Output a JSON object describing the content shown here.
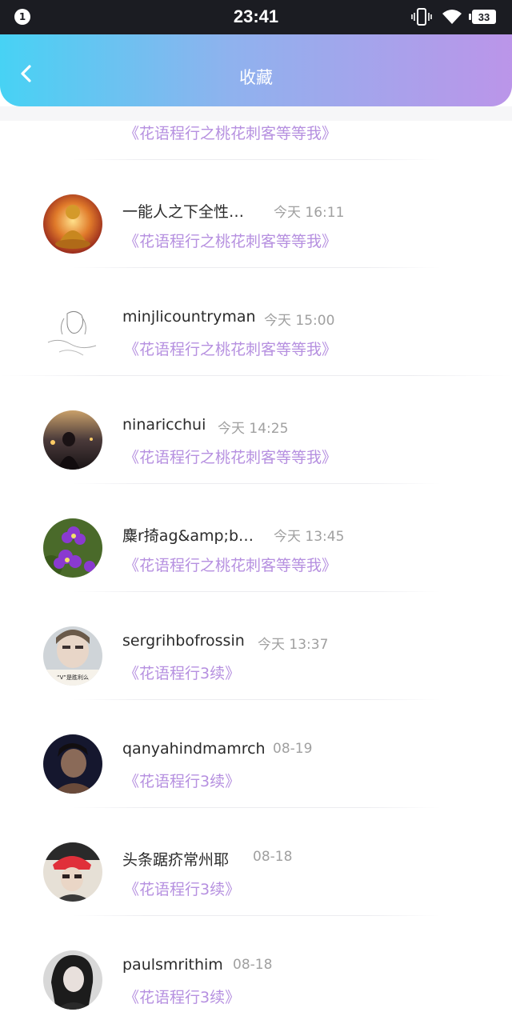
{
  "status_bar": {
    "notification_count": "1",
    "time": "23:41",
    "battery": "33"
  },
  "header": {
    "title": "收藏"
  },
  "items": [
    {
      "name": "",
      "time": "",
      "book": "《花语程行之桃花刺客等等我》"
    },
    {
      "name": "一能人之下全性…",
      "time": "今天 16:11",
      "book": "《花语程行之桃花刺客等等我》"
    },
    {
      "name": "minjlicountryman",
      "time": "今天 15:00",
      "book": "《花语程行之桃花刺客等等我》"
    },
    {
      "name": "ninaricchui",
      "time": "今天 14:25",
      "book": "《花语程行之桃花刺客等等我》"
    },
    {
      "name": "麋r掎ag&amp;b…",
      "time": "今天 13:45",
      "book": "《花语程行之桃花刺客等等我》"
    },
    {
      "name": "sergrihbofrossin",
      "time": "今天 13:37",
      "book": "《花语程行3续》"
    },
    {
      "name": "qanyahindmamrch",
      "time": "08-19",
      "book": "《花语程行3续》"
    },
    {
      "name": "头条踞疥常州耶",
      "time": "08-18",
      "book": "《花语程行3续》"
    },
    {
      "name": "paulsmrithim",
      "time": "08-18",
      "book": "《花语程行3续》"
    }
  ],
  "avatar_captions": {
    "item_5": "“V”是胜利么"
  },
  "colors": {
    "accent_purple": "#b690e0",
    "header_gradient_start": "#47d2f4",
    "header_gradient_end": "#bb95e9"
  }
}
